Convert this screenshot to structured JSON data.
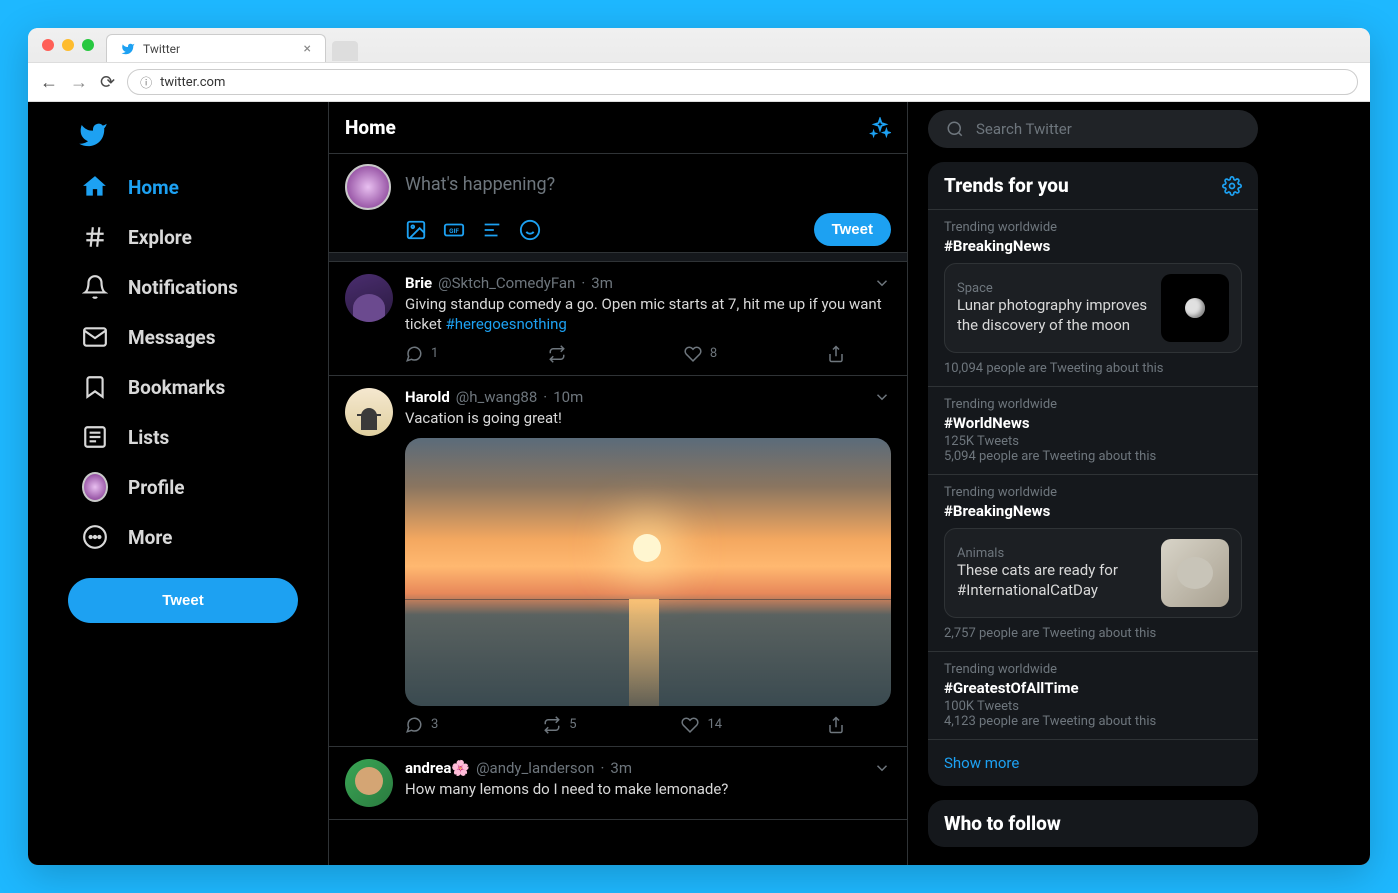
{
  "browser": {
    "tab_title": "Twitter",
    "url": "twitter.com"
  },
  "sidebar": {
    "items": [
      {
        "label": "Home",
        "active": true
      },
      {
        "label": "Explore"
      },
      {
        "label": "Notifications"
      },
      {
        "label": "Messages"
      },
      {
        "label": "Bookmarks"
      },
      {
        "label": "Lists"
      },
      {
        "label": "Profile"
      },
      {
        "label": "More"
      }
    ],
    "tweet_button": "Tweet"
  },
  "main": {
    "header": "Home",
    "compose_placeholder": "What's happening?",
    "compose_button": "Tweet"
  },
  "tweets": [
    {
      "name": "Brie",
      "handle": "@Sktch_ComedyFan",
      "time": "3m",
      "text": "Giving standup comedy a go. Open mic starts at 7, hit me up if you want ticket ",
      "hashtag": "#heregoesnothing",
      "replies": "1",
      "retweets": "",
      "likes": "8"
    },
    {
      "name": "Harold",
      "handle": "@h_wang88",
      "time": "10m",
      "text": "Vacation is going great!",
      "replies": "3",
      "retweets": "5",
      "likes": "14"
    },
    {
      "name": "andrea",
      "emoji": "🌸",
      "handle": "@andy_landerson",
      "time": "3m",
      "text": "How many lemons do I need to make lemonade?"
    }
  ],
  "search": {
    "placeholder": "Search Twitter"
  },
  "trends": {
    "header": "Trends for you",
    "items": [
      {
        "meta": "Trending worldwide",
        "title": "#BreakingNews",
        "card": {
          "category": "Space",
          "desc": "Lunar photography improves the discovery of the moon"
        },
        "footer": "10,094 people are Tweeting about this"
      },
      {
        "meta": "Trending worldwide",
        "title": "#WorldNews",
        "tweets": "125K Tweets",
        "footer": "5,094 people are Tweeting about this"
      },
      {
        "meta": "Trending worldwide",
        "title": "#BreakingNews",
        "card": {
          "category": "Animals",
          "desc": "These cats are ready for #InternationalCatDay"
        },
        "footer": "2,757 people are Tweeting about this"
      },
      {
        "meta": "Trending worldwide",
        "title": "#GreatestOfAllTime",
        "tweets": "100K Tweets",
        "footer": "4,123 people are Tweeting about this"
      }
    ],
    "show_more": "Show more"
  },
  "who": {
    "header": "Who to follow"
  }
}
